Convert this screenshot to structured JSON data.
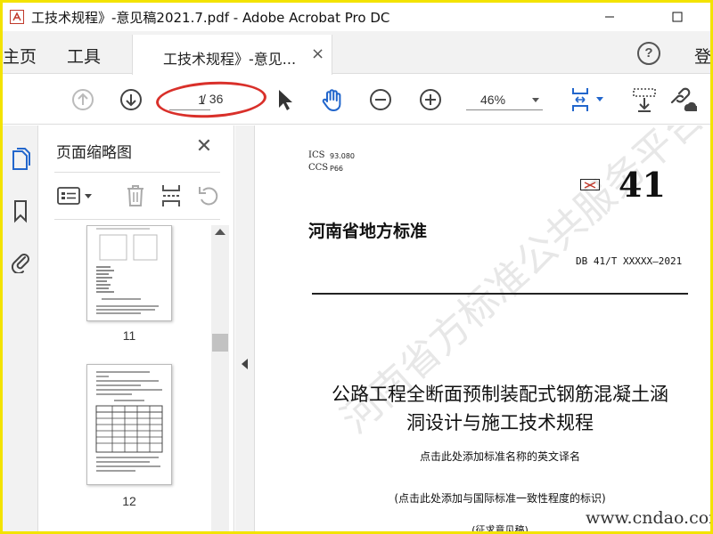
{
  "window": {
    "title": "工技术规程》-意见稿2021.7.pdf - Adobe Acrobat Pro DC",
    "minimize": "—",
    "maximize": "□"
  },
  "tabs": {
    "home": "主页",
    "tools": "工具",
    "document": "工技术规程》-意见...",
    "close": "×",
    "help": "?",
    "login": "登"
  },
  "toolbar": {
    "page_current": "1",
    "page_total": "/ 36",
    "zoom": "46%"
  },
  "panel": {
    "title": "页面缩略图",
    "close": "✕",
    "thumbnails": [
      {
        "page": "11"
      },
      {
        "page": "12"
      }
    ]
  },
  "document": {
    "ics_label": "ICS",
    "ics_value": "93.080",
    "ccs_label": "CCS",
    "ccs_value": "P66",
    "std_number": "41",
    "std_title": "河南省地方标准",
    "std_code": "DB 41/T XXXXX—2021",
    "main_title_line1": "公路工程全断面预制装配式钢筋混凝土涵",
    "main_title_line2": "洞设计与施工技术规程",
    "english_title_hint": "点击此处添加标准名称的英文译名",
    "consistency_hint": "(点击此处添加与国际标准一致性程度的标识)",
    "draft": "(征求意见稿)",
    "watermark": "河南省方标准公共服务平台",
    "site_watermark": "www.cndao.com"
  },
  "colors": {
    "frame": "#f3e300",
    "accent_blue": "#2266cc",
    "annotation_red": "#d9302a"
  }
}
